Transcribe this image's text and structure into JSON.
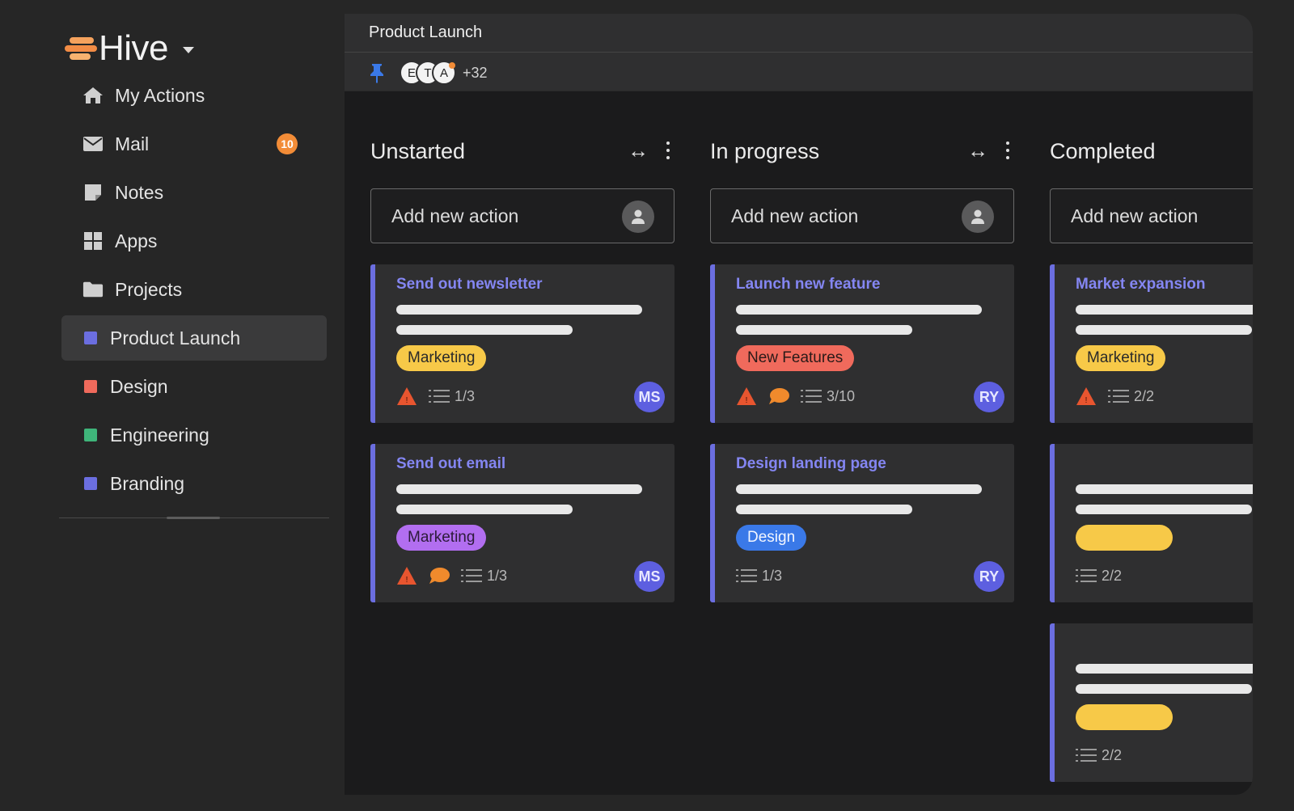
{
  "app": {
    "name": "Hive",
    "colors": {
      "accent": "#f28c37",
      "card_accent": "#6b6ee0",
      "title_link": "#8486f2"
    }
  },
  "sidebar": {
    "items": [
      {
        "label": "My Actions",
        "icon": "home-icon"
      },
      {
        "label": "Mail",
        "icon": "mail-icon",
        "badge": "10"
      },
      {
        "label": "Notes",
        "icon": "notes-icon"
      },
      {
        "label": "Apps",
        "icon": "apps-grid-icon"
      },
      {
        "label": "Projects",
        "icon": "folder-icon"
      }
    ],
    "projects": [
      {
        "label": "Product Launch",
        "color": "#6b6ee0",
        "active": true
      },
      {
        "label": "Design",
        "color": "#f06a5c"
      },
      {
        "label": "Engineering",
        "color": "#3fb57a"
      },
      {
        "label": "Branding",
        "color": "#6b6ee0"
      }
    ]
  },
  "header": {
    "title": "Product Launch",
    "members": [
      "E",
      "T",
      "A"
    ],
    "members_more": "+32"
  },
  "board": {
    "add_placeholder": "Add new action",
    "expand_glyph": "↔",
    "columns": [
      {
        "title": "Unstarted",
        "cards": [
          {
            "title": "Send out newsletter",
            "tag": "Marketing",
            "tag_color": "yellow",
            "warning": true,
            "comment": false,
            "checklist": "1/3",
            "assignee": "MS"
          },
          {
            "title": "Send out email",
            "tag": "Marketing",
            "tag_color": "purple",
            "warning": true,
            "comment": true,
            "checklist": "1/3",
            "assignee": "MS"
          }
        ]
      },
      {
        "title": "In progress",
        "cards": [
          {
            "title": "Launch new feature",
            "tag": "New Features",
            "tag_color": "red",
            "warning": true,
            "comment": true,
            "checklist": "3/10",
            "assignee": "RY"
          },
          {
            "title": "Design landing page",
            "tag": "Design",
            "tag_color": "blue",
            "warning": false,
            "comment": false,
            "checklist": "1/3",
            "assignee": "RY"
          }
        ]
      },
      {
        "title": "Completed",
        "cards": [
          {
            "title": "Market expansion",
            "tag": "Marketing",
            "tag_color": "yellow",
            "warning": true,
            "comment": false,
            "checklist": "2/2"
          },
          {
            "checklist": "2/2"
          },
          {
            "checklist": "2/2"
          }
        ]
      }
    ]
  }
}
